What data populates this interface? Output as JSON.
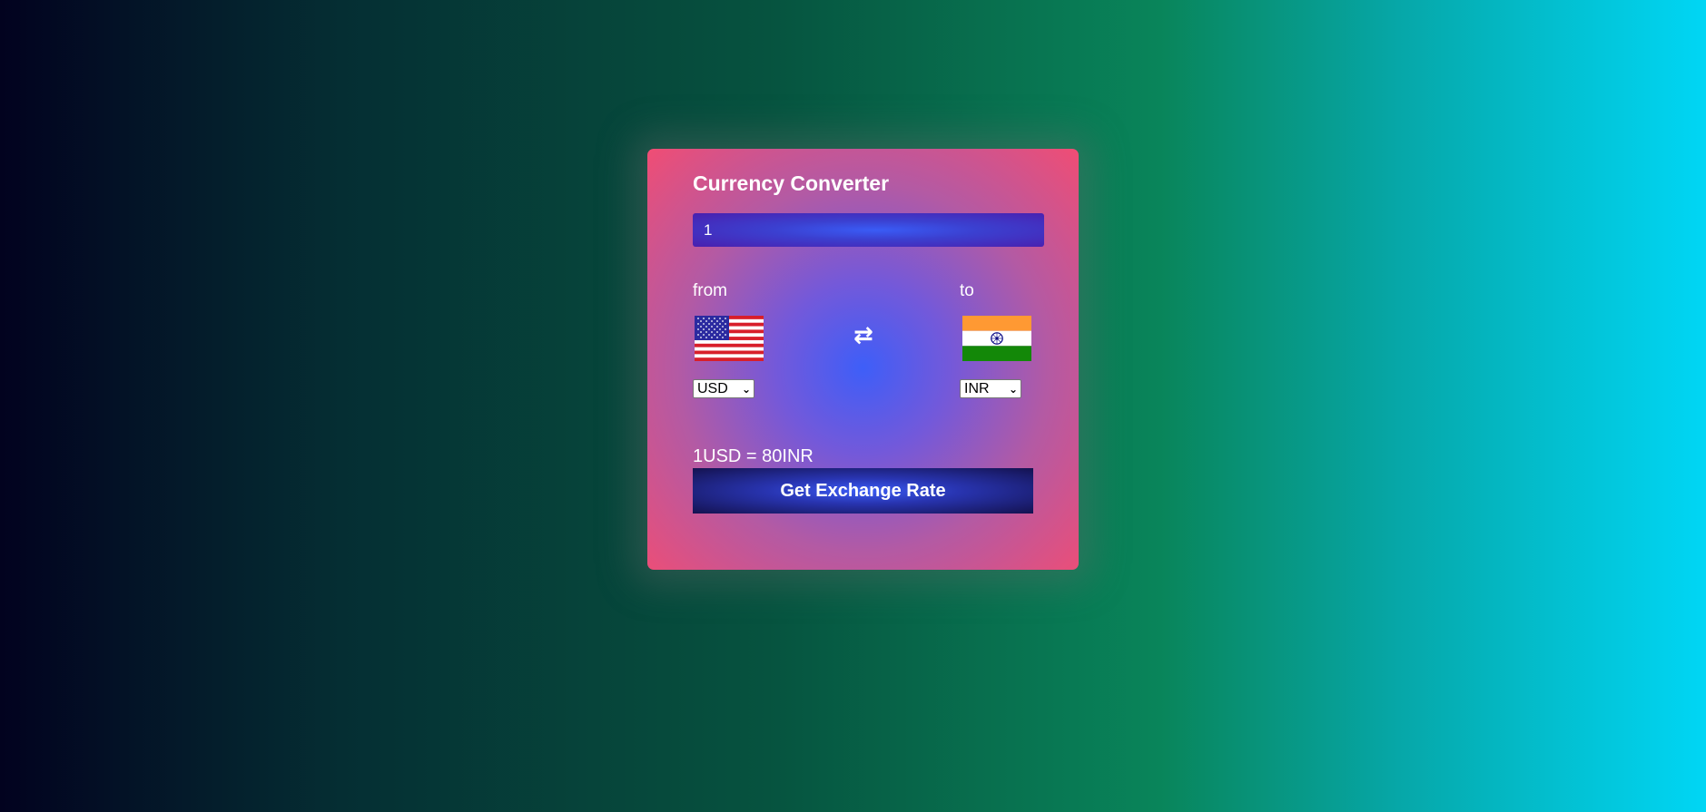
{
  "app": {
    "title": "Currency Converter"
  },
  "amount": {
    "value": "1"
  },
  "from": {
    "label": "from",
    "currency": "USD",
    "flag": "us-flag-icon"
  },
  "to": {
    "label": "to",
    "currency": "INR",
    "flag": "india-flag-icon"
  },
  "swap": {
    "glyph": "⇄",
    "icon": "swap-icon"
  },
  "result": {
    "text": "1USD = 80INR"
  },
  "button": {
    "label": "Get Exchange Rate"
  },
  "colors": {
    "card_edge": "#f04d74",
    "card_center": "#3e5ef8",
    "text": "#ffffff"
  }
}
